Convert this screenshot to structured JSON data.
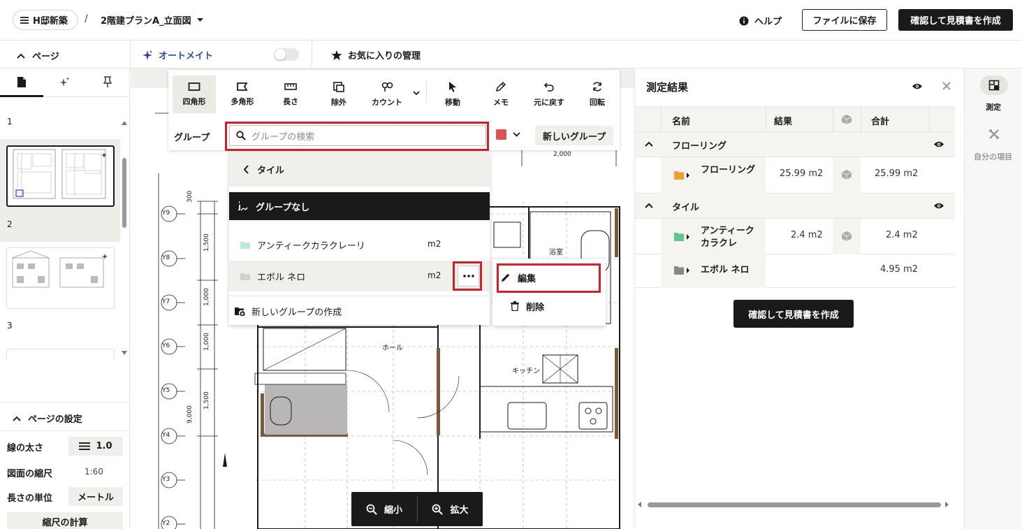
{
  "header": {
    "project": "H邸新築",
    "separator": "/",
    "document": "2階建プランA_立面図",
    "help": "ヘルプ",
    "save": "ファイルに保存",
    "confirm": "確認して見積書を作成"
  },
  "subheader": {
    "pages": "ページ",
    "automate": "オートメイト",
    "favorites": "お気に入りの管理"
  },
  "sidebar": {
    "page_numbers": [
      "1",
      "2",
      "3"
    ],
    "settings_title": "ページの設定",
    "line_width_label": "線の太さ",
    "line_width_value": "1.0",
    "scale_label": "図面の縮尺",
    "scale_value": "1:60",
    "unit_label": "長さの単位",
    "unit_value": "メートル",
    "calc_scale": "縮尺の計算"
  },
  "toolbar": {
    "tools": [
      "四角形",
      "多角形",
      "長さ",
      "除外",
      "カウント",
      "移動",
      "メモ",
      "元に戻す",
      "回転"
    ],
    "group_label": "グループ",
    "search_placeholder": "グループの検索",
    "new_group": "新しいグループ",
    "group_color": "#d9534f"
  },
  "group_dropdown": {
    "back": "タイル",
    "no_group": "グループなし",
    "items": [
      {
        "name": "アンティークカラクレーリ",
        "unit": "m2"
      },
      {
        "name": "エボル ネロ",
        "unit": "m2"
      }
    ],
    "create": "新しいグループの作成"
  },
  "context_menu": {
    "edit": "編集",
    "delete": "削除"
  },
  "drawing": {
    "axis_labels": [
      "Y9",
      "Y8",
      "Y7",
      "Y6",
      "Y5",
      "Y4",
      "Y3",
      "Y2"
    ],
    "dims": [
      "300",
      "1,500",
      "1,000",
      "1,000",
      "1,500",
      "9,000",
      "2,000"
    ],
    "rooms": [
      "浴室",
      "ホール",
      "キッチン"
    ],
    "zoom_out": "縮小",
    "zoom_in": "拡大"
  },
  "results": {
    "title": "測定結果",
    "columns": [
      "名前",
      "結果",
      "合計"
    ],
    "groups": [
      {
        "name": "フローリング",
        "rows": [
          {
            "name": "フローリング",
            "result": "25.99 m2",
            "total": "25.99 m2",
            "color": "#f0a030"
          }
        ]
      },
      {
        "name": "タイル",
        "rows": [
          {
            "name": "アンティークカラクレ",
            "result": "2.4 m2",
            "total": "2.4 m2",
            "color": "#5cc98a"
          },
          {
            "name": "エボル ネロ",
            "result": "",
            "total": "4.95 m2",
            "color": "#888888"
          }
        ]
      }
    ],
    "confirm": "確認して見積書を作成"
  },
  "rail": {
    "measure": "測定",
    "custom": "自分の項目"
  }
}
